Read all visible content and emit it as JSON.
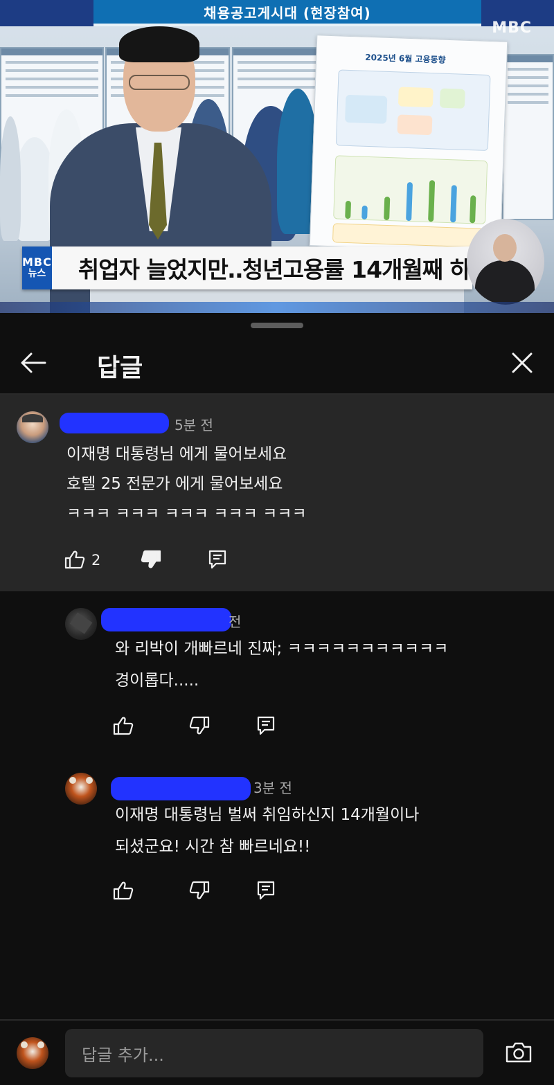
{
  "video": {
    "top_banner": "채용공고게시대 (현장참여)",
    "watermark": "MBC",
    "poster_title": "2025년 6월 고용동향",
    "lower_third": {
      "logo_line1": "MBC",
      "logo_line2": "뉴스",
      "headline": "취업자 늘었지만‥청년고용률 14개월째 하락"
    }
  },
  "panel": {
    "title": "답글",
    "back_icon": "arrow-left-icon",
    "close_icon": "close-icon"
  },
  "comments": [
    {
      "timestamp": "5분 전",
      "lines": [
        "이재명 대통령님 에게 물어보세요",
        "호텔  25  전문가 에게 물어보세요",
        "ㅋㅋㅋ ㅋㅋㅋ ㅋㅋㅋ ㅋㅋㅋ ㅋㅋㅋ"
      ],
      "like_count": "2"
    },
    {
      "timestamp": "전",
      "lines": [
        "와 리박이 개빠르네 진짜; ㅋㅋㅋㅋㅋㅋㅋㅋㅋㅋㅋ",
        "경이롭다....."
      ],
      "like_count": ""
    },
    {
      "timestamp": "3분 전",
      "lines": [
        "이재명 대통령님 벌써 취임하신지 14개월이나",
        "되셨군요! 시간 참 빠르네요!!"
      ],
      "like_count": ""
    }
  ],
  "compose": {
    "placeholder": "답글 추가..."
  },
  "colors": {
    "background": "#0f0f0f",
    "highlight_comment_bg": "#272727",
    "name_redaction": "#2233ff",
    "text_primary": "#f1f1f1",
    "text_secondary": "#aaaaaa"
  }
}
